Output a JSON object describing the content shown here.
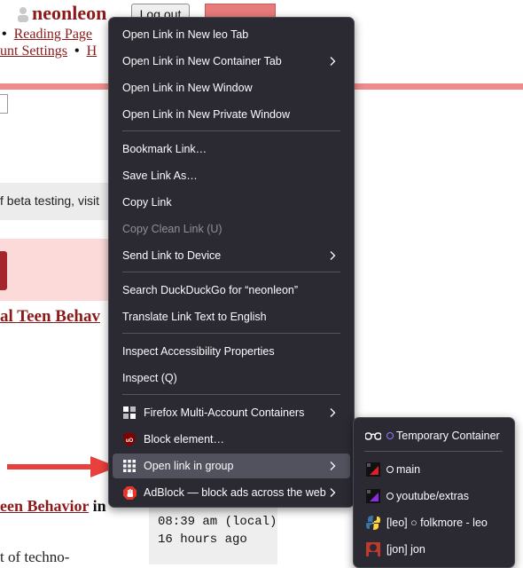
{
  "page": {
    "username": "neonleon",
    "logout_label": "Log out",
    "nav": {
      "reading_page": "Reading Page",
      "account_settings": "unt Settings",
      "h_link": "H"
    },
    "beta_text": "f beta testing, visit",
    "teen_link": "al Teen Behav",
    "teen_link2": "een Behavior",
    "teen_link2_suffix": " in",
    "time_local": "08:39 am (local)",
    "time_ago": "16 hours ago",
    "techno_text": "t of techno-"
  },
  "context_menu": {
    "items": [
      {
        "label": "Open Link in New leo Tab"
      },
      {
        "label": "Open Link in New Container Tab",
        "submenu": true
      },
      {
        "label": "Open Link in New Window"
      },
      {
        "label": "Open Link in New Private Window"
      },
      {
        "label": "Bookmark Link…"
      },
      {
        "label": "Save Link As…"
      },
      {
        "label": "Copy Link"
      },
      {
        "label": "Copy Clean Link (U)",
        "disabled": true
      },
      {
        "label": "Send Link to Device",
        "submenu": true
      },
      {
        "label": "Search DuckDuckGo for “neonleon”"
      },
      {
        "label": "Translate Link Text to English"
      },
      {
        "label": "Inspect Accessibility Properties"
      },
      {
        "label": "Inspect (Q)"
      },
      {
        "label": "Firefox Multi-Account Containers",
        "icon": "containers-icon",
        "submenu": true
      },
      {
        "label": "Block element…",
        "icon": "ublock-icon"
      },
      {
        "label": "Open link in group",
        "icon": "grid-icon",
        "submenu": true,
        "highlighted": true
      },
      {
        "label": "AdBlock — block ads across the web",
        "icon": "adblock-hand-icon",
        "submenu": true
      }
    ]
  },
  "group_submenu": {
    "items": [
      {
        "label": "Temporary Container",
        "icon": "glasses-icon"
      },
      {
        "label": "main",
        "icon": "red-black-icon"
      },
      {
        "label": "youtube/extras",
        "icon": "purple-black-icon"
      },
      {
        "label": "[leo] ○ folkmore - leo",
        "icon": "python-icon"
      },
      {
        "label": "[jon] jon",
        "icon": "avatar-icon"
      }
    ]
  },
  "colors": {
    "menu_bg": "#2b2a33",
    "brand_red": "#8b1a1a",
    "arrow_red": "#e8403d"
  }
}
